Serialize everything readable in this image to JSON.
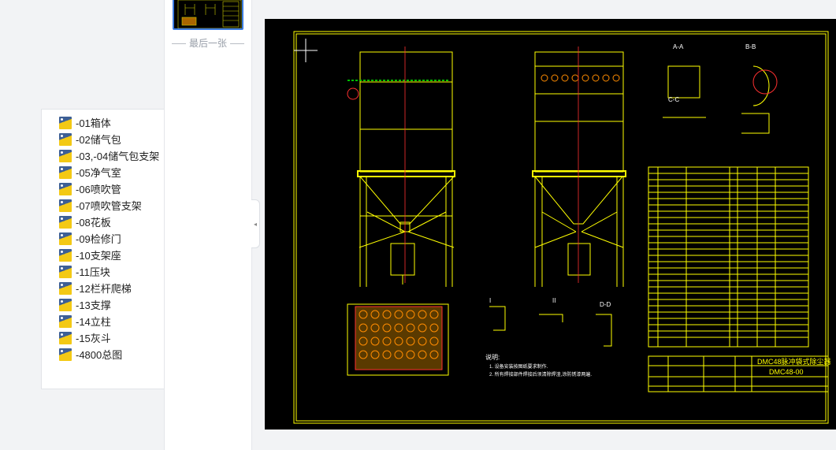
{
  "files": [
    {
      "label": "-01箱体"
    },
    {
      "label": "-02储气包"
    },
    {
      "label": "-03,-04储气包支架"
    },
    {
      "label": "-05净气室"
    },
    {
      "label": "-06喷吹管"
    },
    {
      "label": "-07喷吹管支架"
    },
    {
      "label": "-08花板"
    },
    {
      "label": "-09检修门"
    },
    {
      "label": "-10支架座"
    },
    {
      "label": "-11压块"
    },
    {
      "label": "-12栏杆爬梯"
    },
    {
      "label": "-13支撑"
    },
    {
      "label": "-14立柱"
    },
    {
      "label": "-15灰斗"
    },
    {
      "label": "-4800总图"
    }
  ],
  "thumbnails": {
    "last_label": "最后一张"
  },
  "drawing": {
    "title_name": "DMC48脉冲袋式除尘器",
    "drawing_no": "DMC48-00",
    "section_aa": "A-A",
    "section_bb": "B-B",
    "section_cc": "C-C",
    "section_dd": "D-D",
    "view_i": "I",
    "view_ii": "II",
    "notes_title": "说明:",
    "note1": "1. 设备安装按图纸要求制作.",
    "note2": "2. 所有焊接部件焊接后须清除焊渣,涂防锈漆两遍.",
    "colors": {
      "line": "#ffff00",
      "accent": "#ff3030",
      "green": "#00c000",
      "white": "#ffffff"
    }
  }
}
